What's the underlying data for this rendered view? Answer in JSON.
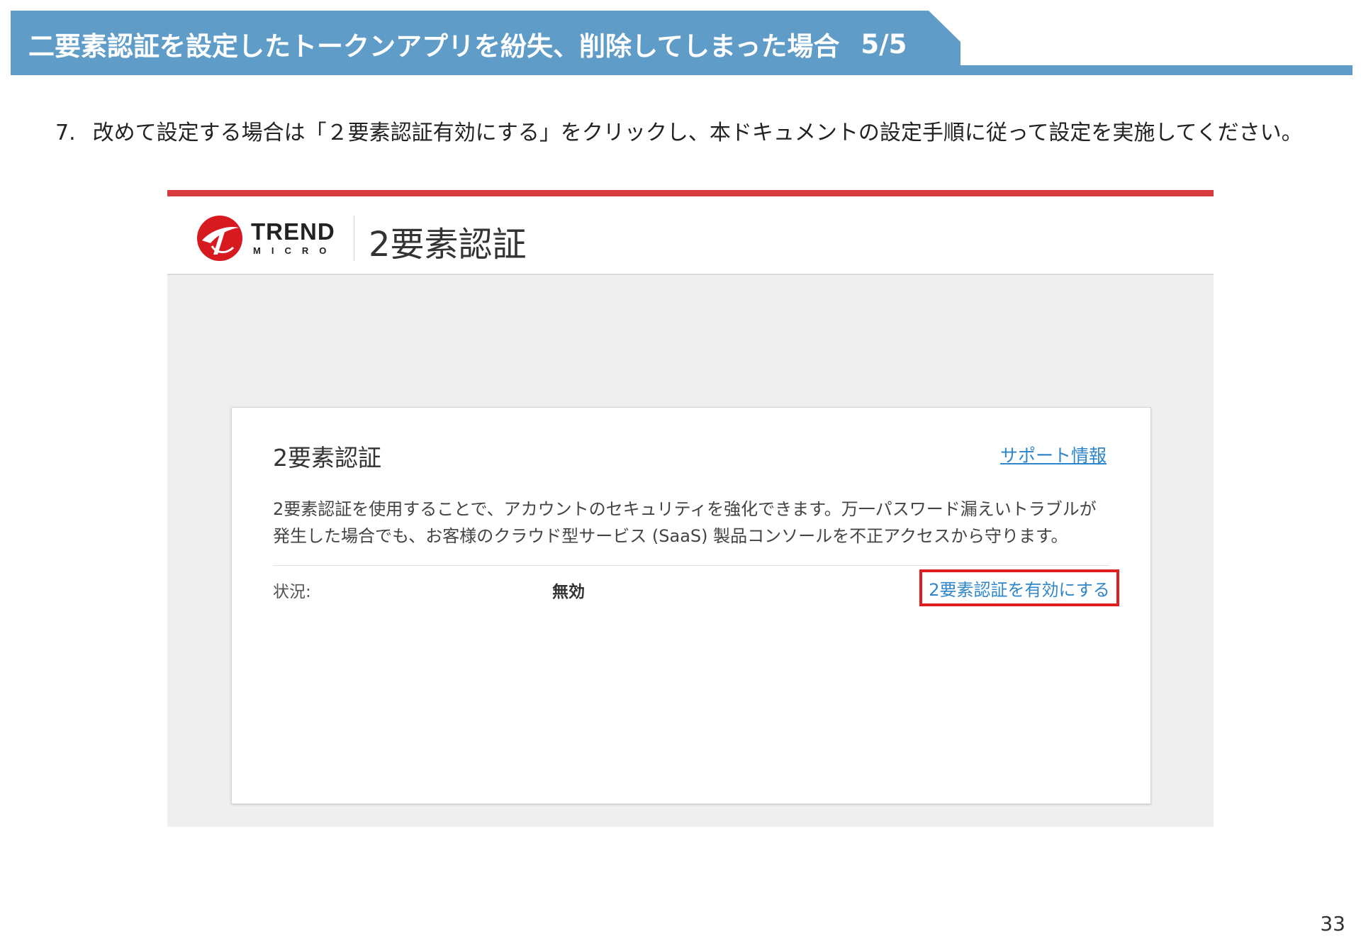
{
  "slide": {
    "title": "二要素認証を設定したトークンアプリを紛失、削除してしまった場合",
    "step": "5/5",
    "instruction_number": "7.",
    "instruction_text": "改めて設定する場合は「２要素認証有効にする」をクリックし、本ドキュメントの設定手順に従って設定を実施してください。",
    "page_number": "33"
  },
  "screenshot": {
    "brand": {
      "trend": "TREND",
      "micro": "MICRO"
    },
    "header_title": "2要素認証",
    "card": {
      "title": "2要素認証",
      "support_link": "サポート情報",
      "description_line1": "2要素認証を使用することで、アカウントのセキュリティを強化できます。万一パスワード漏えいトラブルが",
      "description_line2": "発生した場合でも、お客様のクラウド型サービス (SaaS) 製品コンソールを不正アクセスから守ります。",
      "status_label": "状況:",
      "status_value": "無効",
      "enable_link": "2要素認証を有効にする"
    },
    "colors": {
      "header_blue": "#5f9cc8",
      "brand_red": "#d73a3f",
      "link_blue": "#2f86c8",
      "highlight_red": "#e01e1e"
    }
  }
}
